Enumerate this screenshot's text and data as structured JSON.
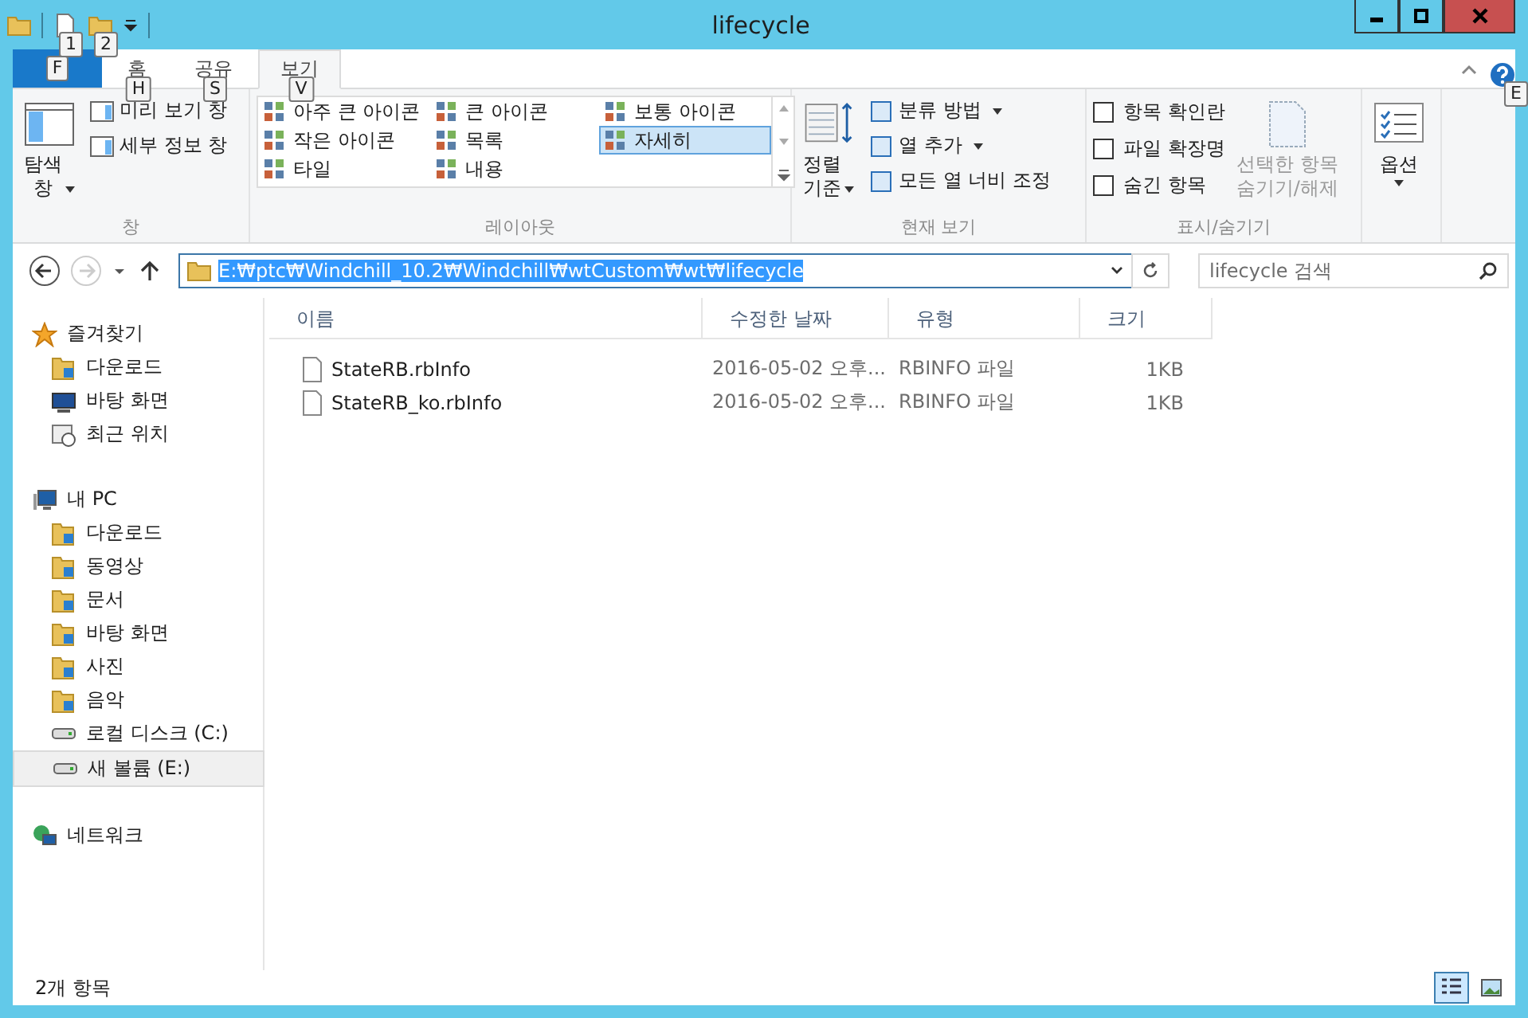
{
  "window": {
    "title": "lifecycle",
    "quick_access_keytips": [
      "1",
      "2"
    ]
  },
  "ribbon": {
    "tabs": [
      {
        "kind": "file",
        "selected": false,
        "keytip": "F"
      },
      {
        "label": "홈",
        "kind": "tab",
        "selected": false,
        "keytip": "H"
      },
      {
        "label": "공유",
        "kind": "tab",
        "selected": false,
        "keytip": "S"
      },
      {
        "label": "보기",
        "kind": "tab",
        "selected": true,
        "keytip": "V"
      }
    ],
    "help_keytip": "E",
    "pane_group": {
      "label": "창",
      "nav_pane": "탐색\n창",
      "items": [
        "미리 보기 창",
        "세부 정보 창"
      ]
    },
    "layout_group": {
      "label": "레이아웃",
      "items": [
        {
          "label": "아주 큰 아이콘",
          "selected": false
        },
        {
          "label": "큰 아이콘",
          "selected": false
        },
        {
          "label": "보통 아이콘",
          "selected": false
        },
        {
          "label": "작은 아이콘",
          "selected": false
        },
        {
          "label": "목록",
          "selected": false
        },
        {
          "label": "자세히",
          "selected": true
        },
        {
          "label": "타일",
          "selected": false
        },
        {
          "label": "내용",
          "selected": false
        }
      ]
    },
    "view_group": {
      "label": "현재 보기",
      "sort": "정렬\n기준",
      "items": [
        {
          "label": "분류 방법",
          "dropdown": true
        },
        {
          "label": "열 추가",
          "dropdown": true
        },
        {
          "label": "모든 열 너비 조정",
          "dropdown": false
        }
      ]
    },
    "showhide_group": {
      "label": "표시/숨기기",
      "checkboxes": [
        {
          "label": "항목 확인란",
          "checked": false
        },
        {
          "label": "파일 확장명",
          "checked": false
        },
        {
          "label": "숨긴 항목",
          "checked": false
        }
      ],
      "hide_selected": {
        "label": "선택한 항목\n숨기기/해제",
        "disabled": true
      }
    },
    "options": {
      "label": "옵션"
    }
  },
  "address": {
    "path": "E:₩ptc₩Windchill_10.2₩Windchill₩wtCustom₩wt₩lifecycle",
    "search_placeholder": "lifecycle 검색"
  },
  "nav": [
    {
      "label": "즐겨찾기",
      "kind": "star",
      "selected": false,
      "children": [
        {
          "label": "다운로드",
          "kind": "folder",
          "selected": false
        },
        {
          "label": "바탕 화면",
          "kind": "desktop",
          "selected": false
        },
        {
          "label": "최근 위치",
          "kind": "recent",
          "selected": false
        }
      ]
    },
    {
      "label": "내 PC",
      "kind": "pc",
      "selected": false,
      "children": [
        {
          "label": "다운로드",
          "kind": "folder",
          "selected": false
        },
        {
          "label": "동영상",
          "kind": "folder",
          "selected": false
        },
        {
          "label": "문서",
          "kind": "folder",
          "selected": false
        },
        {
          "label": "바탕 화면",
          "kind": "folder",
          "selected": false
        },
        {
          "label": "사진",
          "kind": "folder",
          "selected": false
        },
        {
          "label": "음악",
          "kind": "folder",
          "selected": false
        },
        {
          "label": "로컬 디스크 (C:)",
          "kind": "drive",
          "selected": false
        },
        {
          "label": "새 볼륨 (E:)",
          "kind": "drive",
          "selected": true
        }
      ]
    },
    {
      "label": "네트워크",
      "kind": "network",
      "selected": false
    }
  ],
  "table": {
    "columns": [
      "이름",
      "수정한 날짜",
      "유형",
      "크기"
    ],
    "rows": [
      [
        "StateRB.rbInfo",
        "2016-05-02 오후...",
        "RBINFO 파일",
        "1KB"
      ],
      [
        "StateRB_ko.rbInfo",
        "2016-05-02 오후...",
        "RBINFO 파일",
        "1KB"
      ]
    ]
  },
  "status_bar": {
    "count": "2개 항목",
    "views": [
      {
        "kind": "details",
        "selected": true
      },
      {
        "kind": "thumbnails",
        "selected": false
      }
    ]
  }
}
